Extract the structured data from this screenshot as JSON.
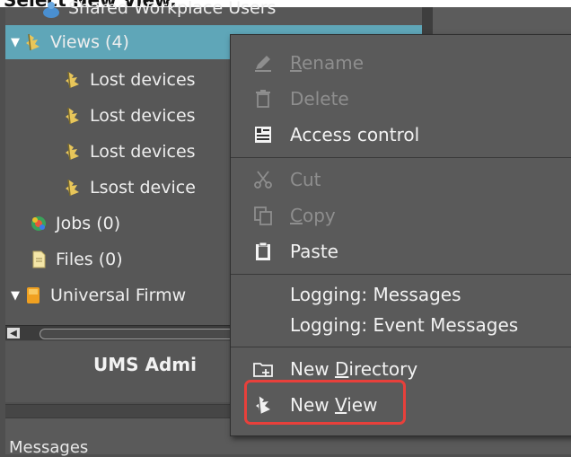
{
  "caption": "Select New View.",
  "tree": {
    "items": [
      {
        "label": "Shared Workplace Users",
        "icon": "users-icon",
        "expander": ""
      },
      {
        "label": "Views (4)",
        "icon": "view-icon",
        "expander": "▼"
      },
      {
        "label": "Lost devices",
        "icon": "view-icon"
      },
      {
        "label": "Lost devices",
        "icon": "view-icon"
      },
      {
        "label": "Lost devices",
        "icon": "view-icon"
      },
      {
        "label": "Lsost device",
        "icon": "view-icon"
      },
      {
        "label": "Jobs (0)",
        "icon": "jobs-icon"
      },
      {
        "label": "Files (0)",
        "icon": "files-icon"
      },
      {
        "label": "Universal Firmw",
        "icon": "firmware-icon",
        "expander": "▼"
      }
    ]
  },
  "admin": {
    "title": "UMS Admi"
  },
  "messages": {
    "label": "Messages"
  },
  "menu": {
    "rename": {
      "prefix": "",
      "underline": "R",
      "suffix": "ename"
    },
    "delete": "Delete",
    "access_control": "Access control",
    "cut": "Cut",
    "copy": {
      "underline": "C",
      "suffix": "opy"
    },
    "paste": "Paste",
    "logging_messages": "Logging: Messages",
    "logging_event_messages": "Logging: Event Messages",
    "new_directory": {
      "prefix": "New ",
      "underline": "D",
      "suffix": "irectory"
    },
    "new_view": {
      "prefix": "New ",
      "underline": "V",
      "suffix": "iew"
    }
  },
  "colors": {
    "selection": "#5fa6b8",
    "highlight": "#e8403b",
    "view_icon": "#e8c65a"
  }
}
